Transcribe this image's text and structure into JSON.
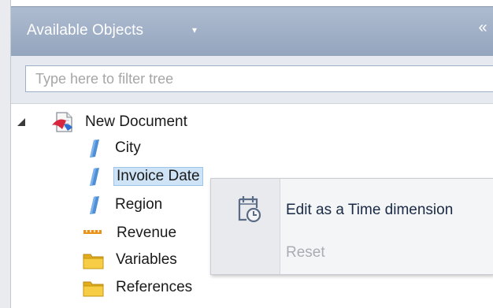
{
  "panel": {
    "title": "Available Objects",
    "title_caret": "▾",
    "collapse_glyph": "«"
  },
  "filter": {
    "placeholder": "Type here to filter tree",
    "value": ""
  },
  "tree": {
    "root": {
      "label": "New Document",
      "icon": "document-icon",
      "expanded": true
    },
    "items": [
      {
        "label": "City",
        "icon": "dimension-icon",
        "selected": false
      },
      {
        "label": "Invoice Date",
        "icon": "dimension-icon",
        "selected": true
      },
      {
        "label": "Region",
        "icon": "dimension-icon",
        "selected": false
      },
      {
        "label": "Revenue",
        "icon": "measure-icon",
        "selected": false
      },
      {
        "label": "Variables",
        "icon": "folder-icon",
        "selected": false
      },
      {
        "label": "References",
        "icon": "folder-icon",
        "selected": false
      }
    ]
  },
  "context_menu": {
    "items": [
      {
        "label": "Edit as a Time dimension",
        "icon": "calendar-clock-icon",
        "enabled": true
      },
      {
        "label": "Reset",
        "enabled": false
      }
    ]
  },
  "colors": {
    "header": "#a3b2c7",
    "selection": "#cfe3f7",
    "dimension": "#4f8fd6",
    "measure": "#e8931c",
    "folder": "#f2c230"
  }
}
